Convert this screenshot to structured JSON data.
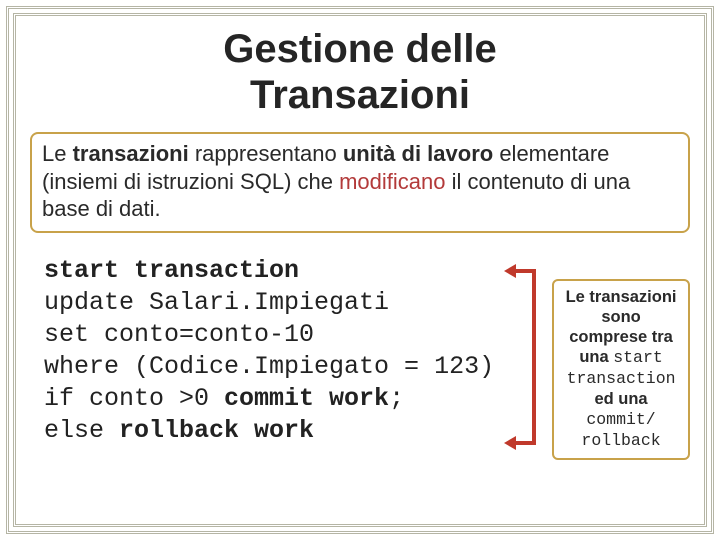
{
  "title": "Gestione delle\nTransazioni",
  "intro": {
    "pre1": "Le ",
    "b1": "transazioni",
    "mid1": " rappresentano ",
    "b2": "unità di lavoro",
    "mid2": " elementare (insiemi di istruzioni SQL) che ",
    "hl": "modificano",
    "post": " il contenuto di una base di dati."
  },
  "code": {
    "l1a": "start transaction",
    "l2": "update Salari.Impiegati",
    "l3": "set conto=conto-10",
    "l4": "where (Codice.Impiegato = 123)",
    "l5a": "if conto >0 ",
    "l5b": "commit work",
    "l5c": ";",
    "l6a": "else ",
    "l6b": "rollback work"
  },
  "note": {
    "t1": "Le transazioni sono comprese tra una ",
    "m1": "start transaction",
    "t2": " ed una ",
    "m2": "commit/\nrollback"
  }
}
